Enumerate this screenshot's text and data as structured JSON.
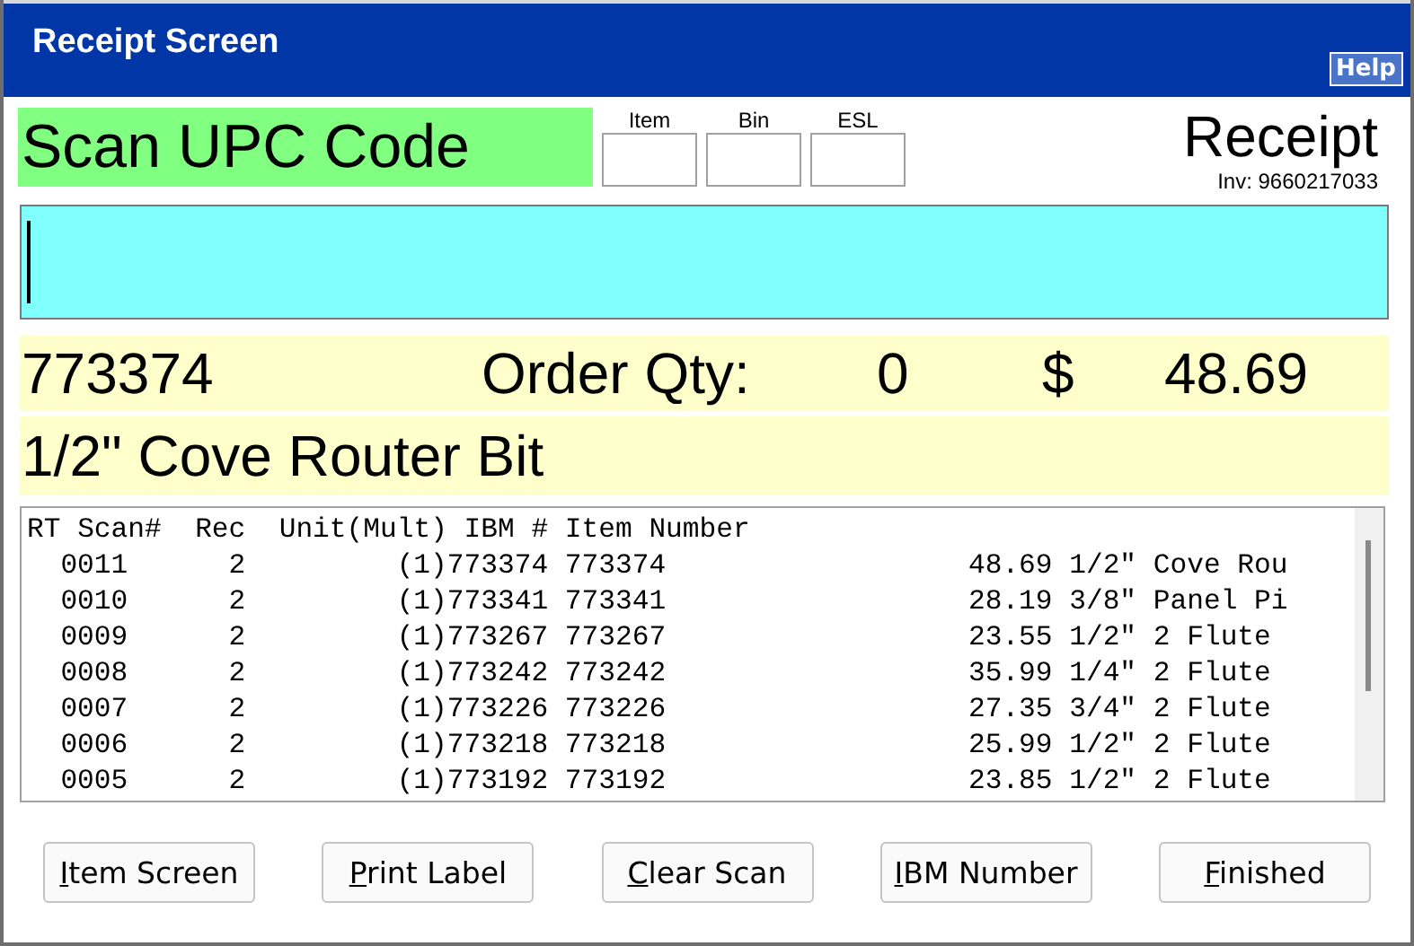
{
  "window": {
    "title": "Receipt Screen",
    "help": "Help"
  },
  "prompt": "Scan UPC Code",
  "mode_fields": [
    {
      "label": "Item"
    },
    {
      "label": "Bin"
    },
    {
      "label": "ESL"
    }
  ],
  "screen_name": "Receipt",
  "invoice": "Inv: 9660217033",
  "current_item": {
    "number": "773374",
    "qty_label": "Order Qty:",
    "qty": "0",
    "currency": "$",
    "price": "48.69",
    "description": "1/2\" Cove Router Bit"
  },
  "list": {
    "columns": [
      "RT Scan#",
      "Rec",
      "Unit(Mult)",
      "IBM #",
      "Item Number"
    ],
    "rows": [
      {
        "scan": "0011",
        "rec": "2",
        "unit": "(1)",
        "ibm": "773374",
        "item_number": "773374",
        "price": "48.69",
        "description": "1/2\" Cove Rou"
      },
      {
        "scan": "0010",
        "rec": "2",
        "unit": "(1)",
        "ibm": "773341",
        "item_number": "773341",
        "price": "28.19",
        "description": "3/8\" Panel Pi"
      },
      {
        "scan": "0009",
        "rec": "2",
        "unit": "(1)",
        "ibm": "773267",
        "item_number": "773267",
        "price": "23.55",
        "description": "1/2\" 2 Flute"
      },
      {
        "scan": "0008",
        "rec": "2",
        "unit": "(1)",
        "ibm": "773242",
        "item_number": "773242",
        "price": "35.99",
        "description": "1/4\" 2 Flute"
      },
      {
        "scan": "0007",
        "rec": "2",
        "unit": "(1)",
        "ibm": "773226",
        "item_number": "773226",
        "price": "27.35",
        "description": "3/4\" 2 Flute"
      },
      {
        "scan": "0006",
        "rec": "2",
        "unit": "(1)",
        "ibm": "773218",
        "item_number": "773218",
        "price": "25.99",
        "description": "1/2\" 2 Flute"
      },
      {
        "scan": "0005",
        "rec": "2",
        "unit": "(1)",
        "ibm": "773192",
        "item_number": "773192",
        "price": "23.85",
        "description": "1/2\" 2 Flute"
      }
    ]
  },
  "buttons": [
    {
      "label": "Item Screen",
      "underline_first": true
    },
    {
      "label": "Print Label",
      "underline_first": true
    },
    {
      "label": "Clear Scan",
      "underline_first": true
    },
    {
      "label": "IBM Number",
      "underline_first": true
    },
    {
      "label": "Finished",
      "underline_first": true
    }
  ]
}
